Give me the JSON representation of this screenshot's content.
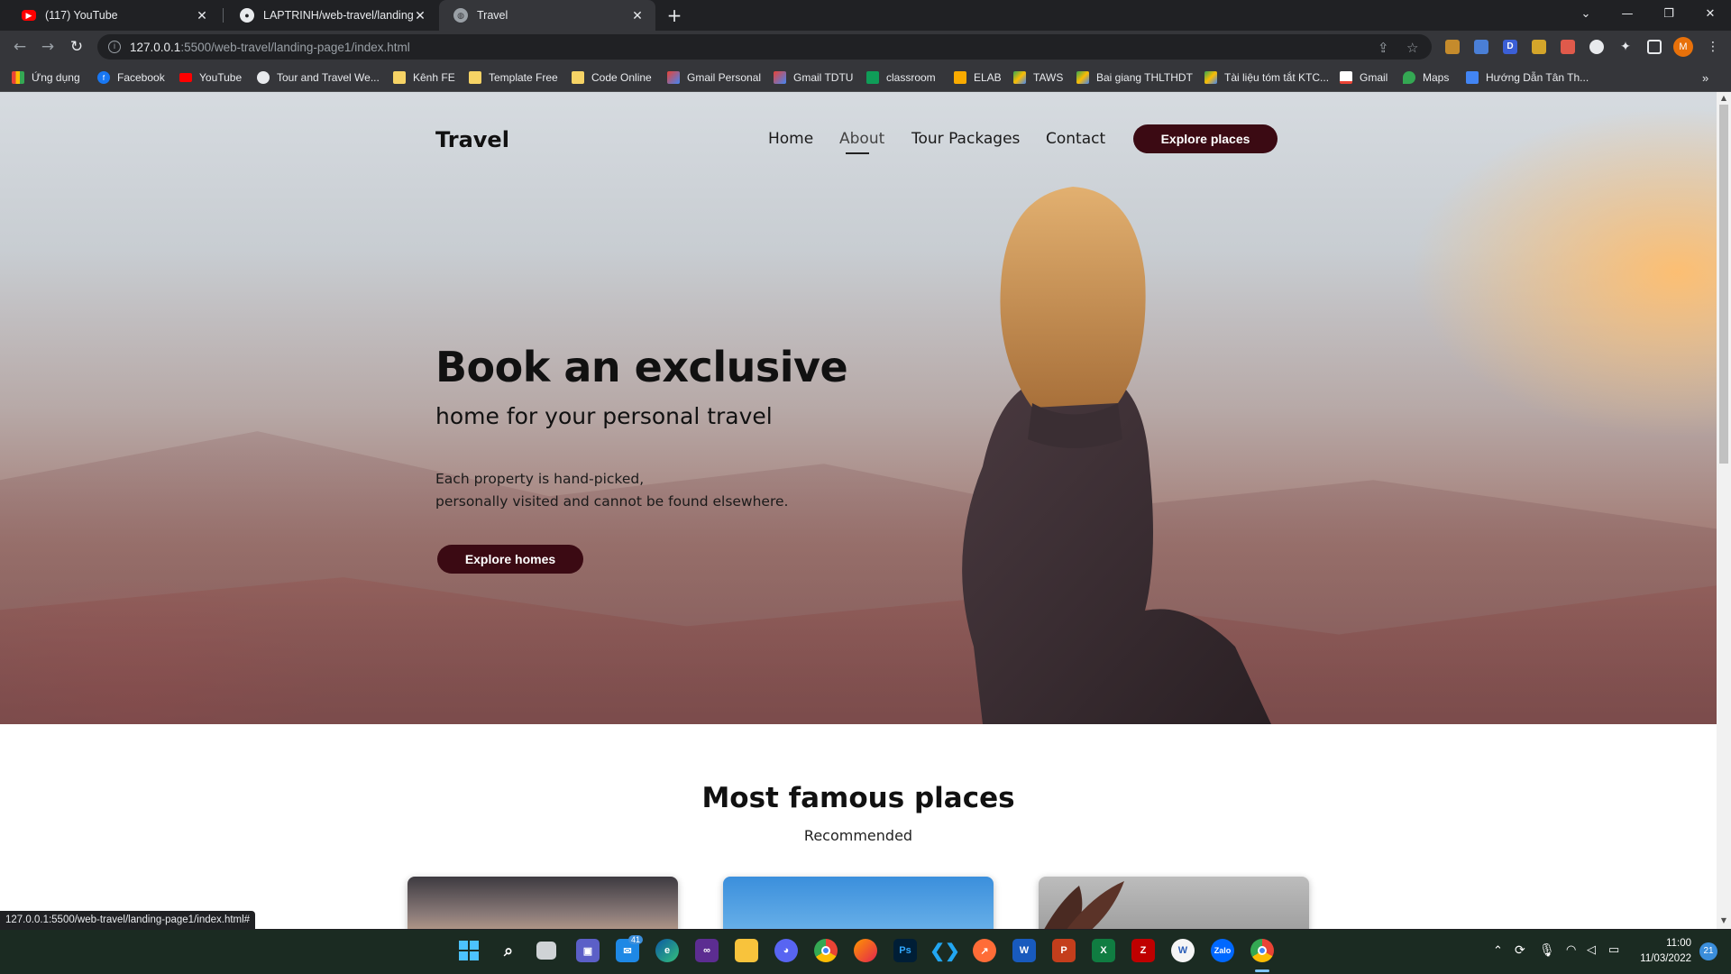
{
  "browser": {
    "tabs": [
      {
        "title": "(117) YouTube",
        "icon": "youtube-icon"
      },
      {
        "title": "LAPTRINH/web-travel/landing-p",
        "icon": "github-icon"
      },
      {
        "title": "Travel",
        "icon": "globe-icon"
      }
    ],
    "url_host": "127.0.0.1",
    "url_path": ":5500/web-travel/landing-page1/index.html",
    "profile_initial": "M",
    "status_url": "127.0.0.1:5500/web-travel/landing-page1/index.html#"
  },
  "bookmarks": [
    {
      "label": "Ứng dụng",
      "icon": "apps-icon",
      "color": "#ea4335"
    },
    {
      "label": "Facebook",
      "icon": "facebook-icon",
      "color": "#1877f2"
    },
    {
      "label": "YouTube",
      "icon": "youtube-icon",
      "color": "#ff0000"
    },
    {
      "label": "Tour and Travel We...",
      "icon": "site-icon",
      "color": "#5f6368"
    },
    {
      "label": "Kênh FE",
      "icon": "folder-icon",
      "color": "#f6d365"
    },
    {
      "label": "Template Free",
      "icon": "folder-icon",
      "color": "#f6d365"
    },
    {
      "label": "Code Online",
      "icon": "folder-icon",
      "color": "#f6d365"
    },
    {
      "label": "Gmail Personal",
      "icon": "gmail-icon",
      "color": "#ea4335"
    },
    {
      "label": "Gmail TDTU",
      "icon": "gmail-icon",
      "color": "#ea4335"
    },
    {
      "label": "classroom",
      "icon": "classroom-icon",
      "color": "#0f9d58"
    },
    {
      "label": "ELAB",
      "icon": "chart-icon",
      "color": "#f9ab00"
    },
    {
      "label": "TAWS",
      "icon": "drive-icon",
      "color": "#34a853"
    },
    {
      "label": "Bai giang THLTHDT",
      "icon": "drive-icon",
      "color": "#34a853"
    },
    {
      "label": "Tài liệu tóm tắt KTC...",
      "icon": "drive-icon",
      "color": "#34a853"
    },
    {
      "label": "Gmail",
      "icon": "gmail-icon",
      "color": "#ea4335"
    },
    {
      "label": "Maps",
      "icon": "maps-icon",
      "color": "#34a853"
    },
    {
      "label": "Hướng Dẫn Tân Th...",
      "icon": "docs-icon",
      "color": "#4285f4"
    }
  ],
  "site": {
    "logo": "Travel",
    "nav": [
      "Home",
      "About",
      "Tour Packages",
      "Contact"
    ],
    "nav_active": "About",
    "cta": "Explore places",
    "hero": {
      "title": "Book an exclusive",
      "subtitle": "home for your personal travel",
      "desc_line1": "Each property is hand-picked,",
      "desc_line2": "personally visited and cannot be found elsewhere.",
      "button": "Explore homes"
    },
    "section": {
      "title": "Most famous places",
      "subtitle": "Recommended"
    }
  },
  "taskbar": {
    "apps": [
      "start",
      "search",
      "task-view",
      "teams",
      "mail",
      "edge",
      "visual-studio",
      "file-explorer",
      "discord",
      "chrome",
      "firefox",
      "photoshop",
      "vscode",
      "postman",
      "word",
      "powerpoint",
      "excel",
      "filezilla",
      "wps",
      "zalo",
      "chrome-profile"
    ],
    "mail_badge": "41",
    "clock_time": "11:00",
    "clock_date": "11/03/2022",
    "notification_count": "21"
  },
  "colors": {
    "brand_button": "#3b0a13",
    "taskbar": "#1b2b22",
    "chrome_dark": "#202124"
  }
}
